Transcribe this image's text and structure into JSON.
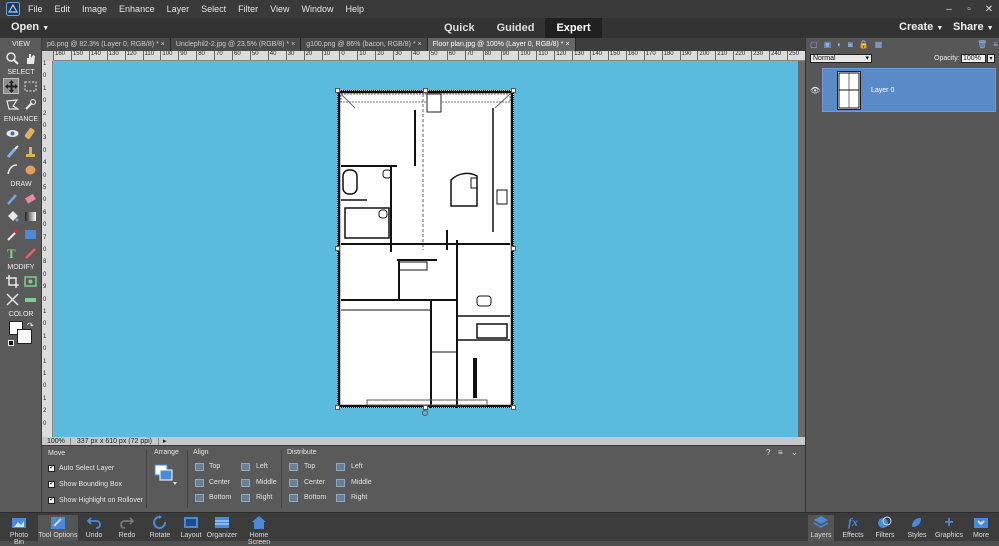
{
  "menu": {
    "items": [
      "File",
      "Edit",
      "Image",
      "Enhance",
      "Layer",
      "Select",
      "Filter",
      "View",
      "Window",
      "Help"
    ],
    "window_controls": [
      "–",
      "▫",
      "✕"
    ]
  },
  "modebar": {
    "open": "Open",
    "modes": [
      "Quick",
      "Guided",
      "Expert"
    ],
    "active_mode": "Expert",
    "create": "Create",
    "share": "Share"
  },
  "toolbox": {
    "sections": [
      "VIEW",
      "SELECT",
      "ENHANCE",
      "DRAW",
      "MODIFY",
      "COLOR"
    ]
  },
  "tabs": [
    {
      "label": "p6.png @ 82.3% (Layer 0, RGB/8) *"
    },
    {
      "label": "Unclephil2-2.jpg @ 23.5% (RGB/8) *"
    },
    {
      "label": "g100.png @ 86% (bacon, RGB/8) *"
    },
    {
      "label": "Floor plan.jpg @ 100% (Layer 0, RGB/8) *"
    }
  ],
  "tab_close": "×",
  "ruler": {
    "h_ticks": [
      "160",
      "150",
      "140",
      "130",
      "120",
      "110",
      "100",
      "90",
      "80",
      "70",
      "60",
      "50",
      "40",
      "30",
      "20",
      "10",
      "0",
      "10",
      "20",
      "30",
      "40",
      "50",
      "60",
      "70",
      "80",
      "90",
      "100",
      "110",
      "120",
      "130",
      "140",
      "150",
      "160",
      "170",
      "180",
      "190",
      "200",
      "210",
      "220",
      "230",
      "240",
      "250"
    ],
    "v_ticks": [
      "1",
      "0",
      "1",
      "0",
      "2",
      "0",
      "3",
      "0",
      "4",
      "0",
      "5",
      "0",
      "6",
      "0",
      "7",
      "0",
      "8",
      "0",
      "9",
      "0",
      "1",
      "0",
      "1",
      "0",
      "1",
      "1",
      "0",
      "1",
      "2",
      "0"
    ]
  },
  "status": {
    "zoom": "100%",
    "dimensions": "337 px x 610 px (72 ppi)"
  },
  "options": {
    "move_title": "Move",
    "arrange_title": "Arrange",
    "align_title": "Align",
    "distribute_title": "Distribute",
    "checkboxes": [
      "Auto Select Layer",
      "Show Bounding Box",
      "Show Highlight on Rollover"
    ],
    "align": [
      "Top",
      "Center",
      "Bottom",
      "Left",
      "Middle",
      "Right"
    ],
    "distribute": [
      "Top",
      "Center",
      "Bottom",
      "Left",
      "Middle",
      "Right"
    ]
  },
  "layers": {
    "blend_mode": "Normal",
    "opacity_label": "Opacity:",
    "opacity_value": "100%",
    "layer_name": "Layer 0"
  },
  "bottombar": {
    "left": [
      "Photo Bin",
      "Tool Options",
      "Undo",
      "Redo",
      "Rotate",
      "Layout",
      "Organizer",
      "Home Screen"
    ],
    "right": [
      "Layers",
      "Effects",
      "Filters",
      "Styles",
      "Graphics",
      "More"
    ]
  },
  "colors": {
    "canvas": "#5bbbde",
    "layer_selected": "#5a8ac8",
    "active_tab": "#666666"
  }
}
